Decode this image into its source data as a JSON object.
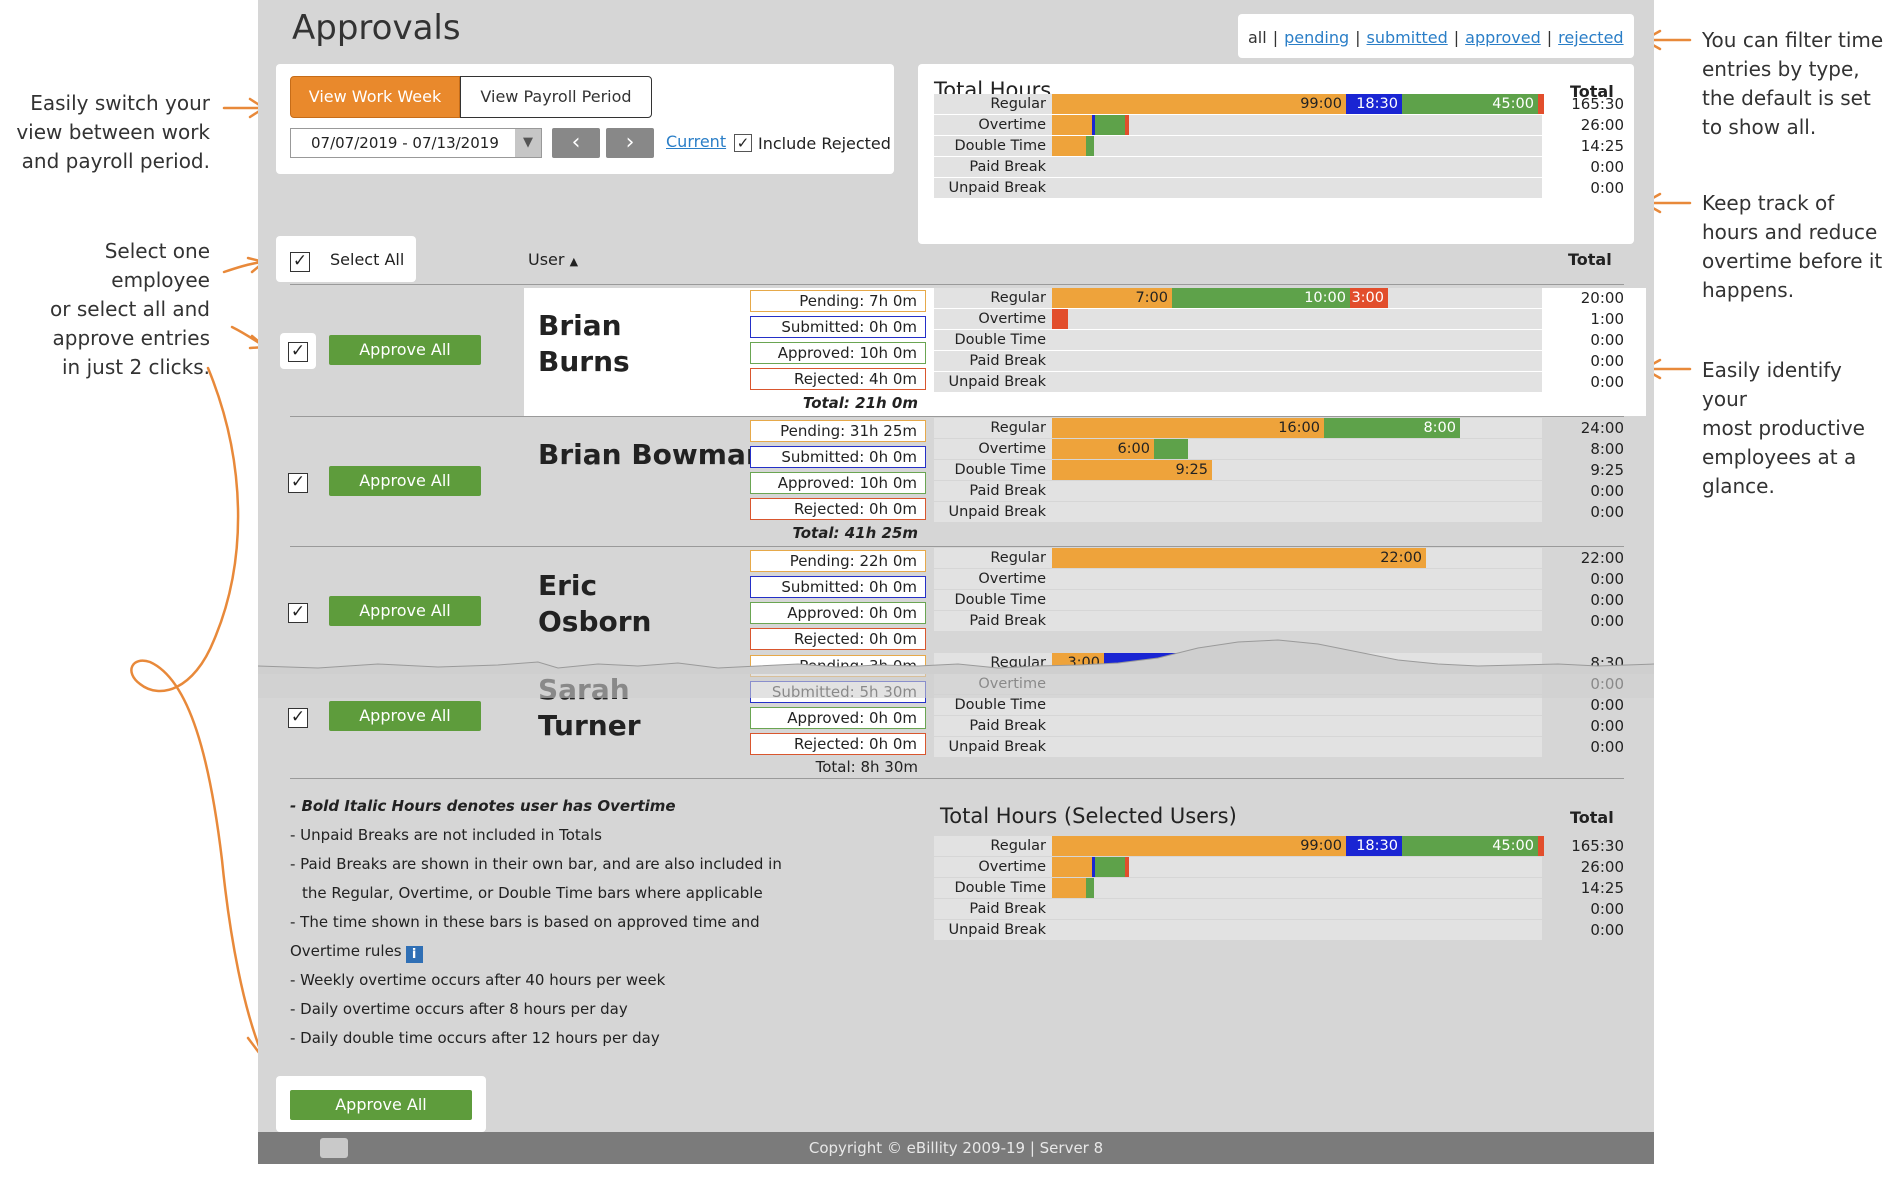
{
  "annotations": {
    "switch_view": [
      "Easily switch your",
      "view between work",
      "and payroll period."
    ],
    "select_employee": [
      "Select one employee",
      "or select all and",
      "approve entries",
      "in just 2 clicks."
    ],
    "filter": [
      "You can filter time",
      "entries by type,",
      "the default is set",
      "to show all."
    ],
    "track_hours": [
      "Keep track of",
      "hours and reduce",
      "overtime before it",
      "happens."
    ],
    "productive": [
      "Easily identify your",
      "most productive",
      "employees at a",
      "glance."
    ]
  },
  "page": {
    "title": "Approvals"
  },
  "filters": {
    "all": "all",
    "pending": "pending",
    "submitted": "submitted",
    "approved": "approved",
    "rejected": "rejected"
  },
  "view": {
    "work_week": "View Work Week",
    "payroll_period": "View Payroll Period",
    "date_range": "07/07/2019 - 07/13/2019",
    "current": "Current",
    "include_rejected": "Include Rejected"
  },
  "hour_labels": [
    "Regular",
    "Overtime",
    "Double Time",
    "Paid Break",
    "Unpaid Break"
  ],
  "total_hours": {
    "title": "Total Hours",
    "total_header": "Total",
    "totals": [
      "165:30",
      "26:00",
      "14:25",
      "0:00",
      "0:00"
    ],
    "reg_segments": [
      "99:00",
      "18:30",
      "45:00"
    ]
  },
  "list": {
    "select_all": "Select All",
    "user_header": "User",
    "total_header": "Total"
  },
  "approve_all": "Approve All",
  "employees": [
    {
      "name": [
        "Brian",
        "Burns"
      ],
      "pending": "Pending: 7h 0m",
      "submitted": "Submitted: 0h 0m",
      "approved": "Approved: 10h 0m",
      "rejected": "Rejected: 4h 0m",
      "total": "Total: 21h 0m",
      "totals": [
        "20:00",
        "1:00",
        "0:00",
        "0:00",
        "0:00"
      ],
      "regular": [
        "7:00",
        "10:00",
        "3:00"
      ]
    },
    {
      "name": [
        "Brian Bowman"
      ],
      "pending": "Pending: 31h 25m",
      "submitted": "Submitted: 0h 0m",
      "approved": "Approved: 10h 0m",
      "rejected": "Rejected: 0h 0m",
      "total": "Total: 41h 25m",
      "totals": [
        "24:00",
        "8:00",
        "9:25",
        "0:00",
        "0:00"
      ],
      "regular": [
        "16:00",
        "8:00"
      ],
      "overtime": [
        "6:00"
      ],
      "double": [
        "9:25"
      ]
    },
    {
      "name": [
        "Eric",
        "Osborn"
      ],
      "pending": "Pending: 22h 0m",
      "submitted": "Submitted: 0h 0m",
      "approved": "Approved: 0h 0m",
      "rejected": "Rejected: 0h 0m",
      "totals": [
        "22:00",
        "0:00",
        "0:00",
        "0:00"
      ],
      "regular": [
        "22:00"
      ]
    },
    {
      "name": [
        "Sarah",
        "Turner"
      ],
      "pending": "Pending: 3h 0m",
      "submitted": "Submitted: 5h 30m",
      "approved": "Approved: 0h 0m",
      "rejected": "Rejected: 0h 0m",
      "total": "Total: 8h 30m",
      "totals": [
        "8:30",
        "0:00",
        "0:00",
        "0:00",
        "0:00"
      ],
      "regular": [
        "3:00",
        "5:30"
      ]
    }
  ],
  "notes": [
    "- Bold Italic Hours denotes user has Overtime",
    "- Unpaid Breaks are not included in Totals",
    "- Paid Breaks are shown in their own bar, and are also included in",
    "the Regular, Overtime, or Double Time bars where applicable",
    "- The time shown in these bars is based on approved time and",
    "Overtime rules",
    "- Weekly overtime occurs after 40 hours per week",
    "- Daily overtime occurs after 8 hours per day",
    "- Daily double time occurs after 12 hours per day"
  ],
  "selected_totals": {
    "title": "Total Hours (Selected Users)",
    "total_header": "Total",
    "totals": [
      "165:30",
      "26:00",
      "14:25",
      "0:00",
      "0:00"
    ],
    "reg_segments": [
      "99:00",
      "18:30",
      "45:00"
    ]
  },
  "footer": {
    "copyright": "Copyright © eBillity 2009-19  |  Server 8"
  },
  "colors": {
    "orange": "#eea33b",
    "blue": "#1a25d3",
    "green": "#5ea24a",
    "red": "#e24e2c",
    "accent": "#e9892c"
  }
}
